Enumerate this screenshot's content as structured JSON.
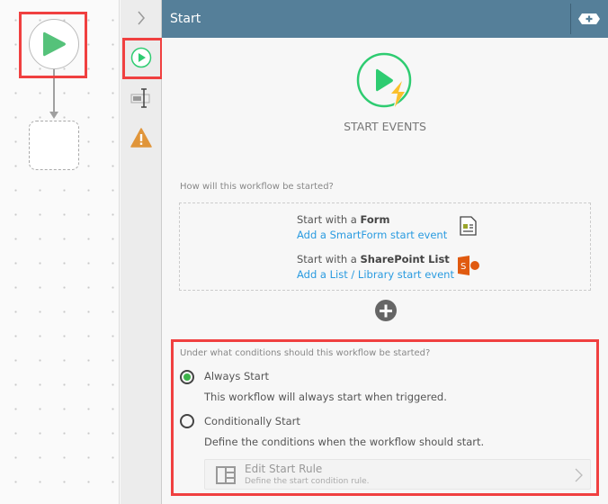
{
  "panel": {
    "title": "Start",
    "start_events_label": "START EVENTS"
  },
  "start_methods": {
    "question": "How will this workflow be started?",
    "form": {
      "prefix": "Start with a ",
      "bold": "Form",
      "link": "Add a SmartForm start event"
    },
    "sharepoint": {
      "prefix": "Start with a ",
      "bold": "SharePoint List",
      "link": "Add a List / Library start event"
    }
  },
  "conditions": {
    "question": "Under what conditions should this workflow be started?",
    "options": [
      {
        "label": "Always Start",
        "description": "This workflow will always start when triggered.",
        "selected": true
      },
      {
        "label": "Conditionally Start",
        "description": "Define the conditions when the workflow should start.",
        "selected": false
      }
    ],
    "rule": {
      "title": "Edit Start Rule",
      "subtitle": "Define the start condition rule."
    }
  },
  "colors": {
    "header": "#557f99",
    "green": "#2ecc71",
    "highlight": "#f04040",
    "link": "#2a9be0"
  }
}
